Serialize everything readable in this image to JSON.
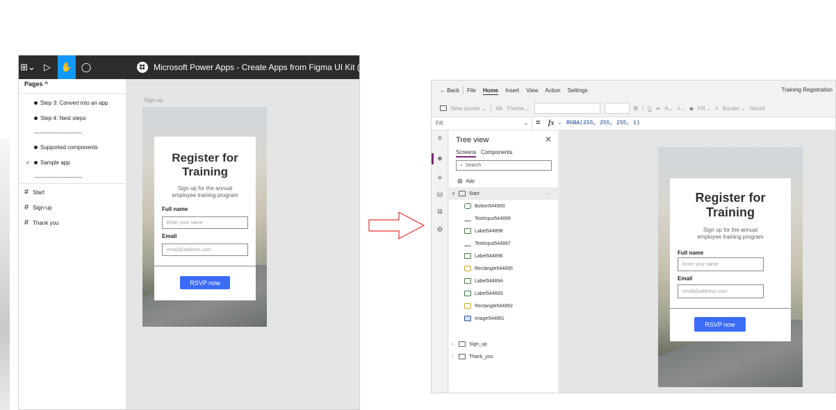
{
  "figma": {
    "title": "Microsoft Power Apps - Create Apps from Figma UI Kit (Preview)",
    "title_chevron": "⌄",
    "tools": [
      {
        "name": "figma-menu",
        "glyph": "⊞⌄"
      },
      {
        "name": "move-tool",
        "glyph": "▷"
      },
      {
        "name": "hand-tool",
        "glyph": "✋"
      },
      {
        "name": "comment-tool",
        "glyph": "◯"
      }
    ],
    "pages_header": "Pages ^",
    "pages": [
      {
        "label": "Step 3: Convert into an app",
        "checked": false,
        "bullet": true
      },
      {
        "label": "Step 4: Next steps",
        "checked": false,
        "bullet": true
      },
      {
        "label": "--------------------------",
        "checked": false,
        "bullet": false
      },
      {
        "label": "Supported components",
        "checked": false,
        "bullet": true
      },
      {
        "label": "Sample app",
        "checked": true,
        "bullet": true
      },
      {
        "label": "--------------------------",
        "checked": false,
        "bullet": false
      }
    ],
    "check_glyph": "✓",
    "hash_glyph": "#",
    "frames": [
      "Start",
      "Sign-up",
      "Thank you"
    ],
    "canvas_label": "Sign-up"
  },
  "form": {
    "title_line1": "Register for",
    "title_line2": "Training",
    "subtitle_line1": "Sign up for the annual",
    "subtitle_line2": "employee training program",
    "full_name_label": "Full name",
    "full_name_placeholder": "Enter your name",
    "email_label": "Email",
    "email_placeholder": "email@address.com",
    "button_label": "RSVP now"
  },
  "powerapps": {
    "menu": {
      "back": "← Back",
      "items": [
        "File",
        "Home",
        "Insert",
        "View",
        "Action",
        "Settings"
      ],
      "active": "Home"
    },
    "app_title": "Training Registration",
    "toolbar": {
      "new_screen": "New screen ⌄",
      "theme": "Theme ⌄",
      "bold": "B",
      "italic": "/",
      "underline": "U",
      "strike": "⇻",
      "font_color": "A⌄",
      "align": "≡⌄",
      "fill": "Fill ⌄",
      "border": "Border ⌄",
      "reorder": "Reord"
    },
    "formula": {
      "property": "Fill",
      "property_chevron": "⌄",
      "equals": "=",
      "fx": "fx",
      "fx_chevron": "⌄",
      "value": "RGBA(255, 255, 255, 1)"
    },
    "tree": {
      "title": "Tree view",
      "close": "✕",
      "tabs": [
        "Screens",
        "Components"
      ],
      "search_placeholder": "Search",
      "app_label": "App",
      "screen_start": "Start",
      "start_more": "···",
      "children": [
        {
          "label": "Button544900",
          "kind": "btn"
        },
        {
          "label": "TextInput544899",
          "kind": "txt"
        },
        {
          "label": "Label544898",
          "kind": "lbl"
        },
        {
          "label": "TextInput544897",
          "kind": "txt"
        },
        {
          "label": "Label544896",
          "kind": "lbl"
        },
        {
          "label": "Rectangle544895",
          "kind": "rect"
        },
        {
          "label": "Label544894",
          "kind": "lbl"
        },
        {
          "label": "Label544893",
          "kind": "lbl"
        },
        {
          "label": "Rectangle544892",
          "kind": "rect"
        },
        {
          "label": "Image544891",
          "kind": "img"
        }
      ],
      "other_screens": [
        "Sign_up",
        "Thank_you"
      ]
    },
    "rail_icons": [
      "hamburger-icon",
      "layers-icon",
      "plus-icon",
      "database-icon",
      "media-icon",
      "tools-icon"
    ],
    "rail_glyphs": [
      "≡",
      "◈",
      "+",
      "⛁",
      "⧉",
      "⚙"
    ]
  },
  "arrow_color": "#e0302e",
  "accent_color": "#3b6cf6"
}
